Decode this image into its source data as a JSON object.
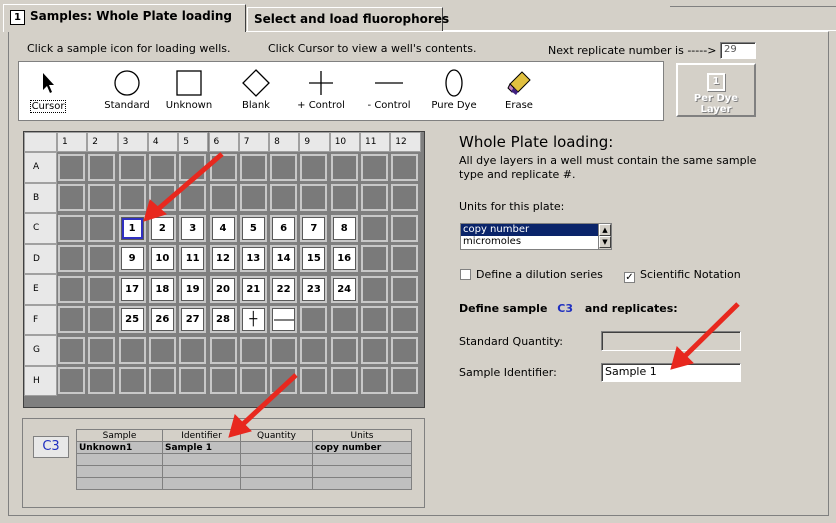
{
  "tabs": [
    {
      "num": "1",
      "label": "Samples: Whole Plate loading"
    },
    {
      "label": "Select and load fluorophores"
    }
  ],
  "instructions": {
    "left": "Click a sample icon for loading wells.",
    "mid": "Click Cursor to view a well's contents.",
    "replicate_label": "Next replicate number is  ----->",
    "replicate_value": "29"
  },
  "tools": [
    "Cursor",
    "Standard",
    "Unknown",
    "Blank",
    "+ Control",
    "- Control",
    "Pure Dye",
    "Erase"
  ],
  "per_dye_layer": {
    "num": "1",
    "label": "Per Dye Layer"
  },
  "plate": {
    "columns": [
      "1",
      "2",
      "3",
      "4",
      "5",
      "6",
      "7",
      "8",
      "9",
      "10",
      "11",
      "12"
    ],
    "rows": [
      "A",
      "B",
      "C",
      "D",
      "E",
      "F",
      "G",
      "H"
    ],
    "cells": {
      "C3": "1",
      "C4": "2",
      "C5": "3",
      "C6": "4",
      "C7": "5",
      "C8": "6",
      "C9": "7",
      "C10": "8",
      "D3": "9",
      "D4": "10",
      "D5": "11",
      "D6": "12",
      "D7": "13",
      "D8": "14",
      "D9": "15",
      "D10": "16",
      "E3": "17",
      "E4": "18",
      "E5": "19",
      "E6": "20",
      "E7": "21",
      "E8": "22",
      "E9": "23",
      "E10": "24",
      "F3": "25",
      "F4": "26",
      "F5": "27",
      "F6": "28"
    },
    "selected": "C3"
  },
  "right": {
    "title": "Whole Plate loading:",
    "desc1": "All dye layers in a well must contain the same sample",
    "desc2": "type and replicate #.",
    "units_label": "Units for this plate:",
    "units_options": [
      "copy number",
      "micromoles"
    ],
    "dilution_label": "Define a dilution series",
    "scinot_label": "Scientific Notation",
    "define_prefix": "Define sample",
    "define_well": "C3",
    "define_suffix": "and replicates:",
    "std_qty_label": "Standard Quantity:",
    "std_qty_value": "",
    "sample_id_label": "Sample Identifier:",
    "sample_id_value": "Sample 1"
  },
  "well_table": {
    "well": "C3",
    "headers": [
      "Sample",
      "Identifier",
      "Quantity",
      "Units"
    ],
    "rows": [
      [
        "Unknown1",
        "Sample 1",
        "",
        "copy number"
      ],
      [
        "",
        "",
        "",
        ""
      ],
      [
        "",
        "",
        "",
        ""
      ],
      [
        "",
        "",
        "",
        ""
      ]
    ]
  },
  "colors": {
    "arrow": "#e8281e",
    "selection": "#0a246a"
  }
}
